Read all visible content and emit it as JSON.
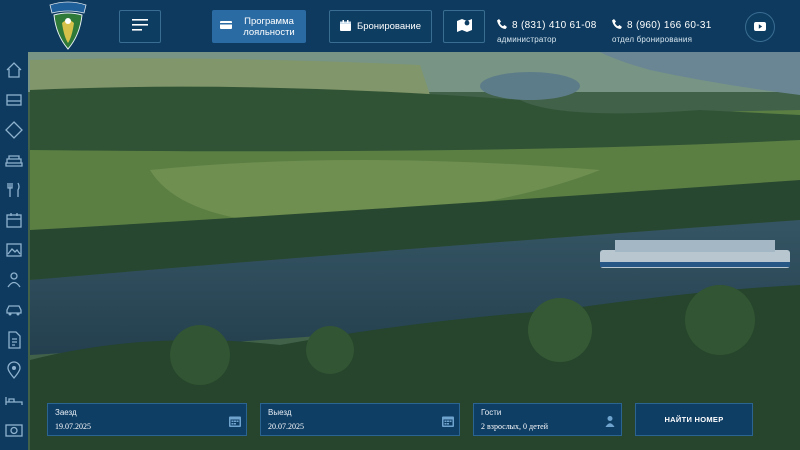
{
  "header": {
    "menu_icon": "hamburger-icon",
    "loyalty_label": "Программа лояльности",
    "booking_label": "Бронирование",
    "map_icon": "map-icon",
    "phone_admin": {
      "number": "8 (831) 410 61-08",
      "caption": "администратор"
    },
    "phone_booking": {
      "number": "8 (960) 166 60-31",
      "caption": "отдел бронирования"
    },
    "youtube_icon": "youtube-icon",
    "accent_color": "#2b6ba3",
    "bar_color": "#0d3a5e"
  },
  "sidebar": {
    "icons": [
      "home-icon",
      "room-icon",
      "diamond-icon",
      "sofa-icon",
      "dining-icon",
      "calendar-icon",
      "gallery-icon",
      "person-icon",
      "car-icon",
      "document-icon",
      "location-icon",
      "bed-icon",
      "photo-icon"
    ]
  },
  "booking_form": {
    "checkin": {
      "label": "Заезд",
      "value": "19.07.2025"
    },
    "checkout": {
      "label": "Выезд",
      "value": "20.07.2025"
    },
    "guests": {
      "label": "Гости",
      "value": "2 взрослых, 0 детей"
    },
    "submit_label": "НАЙТИ НОМЕР"
  }
}
